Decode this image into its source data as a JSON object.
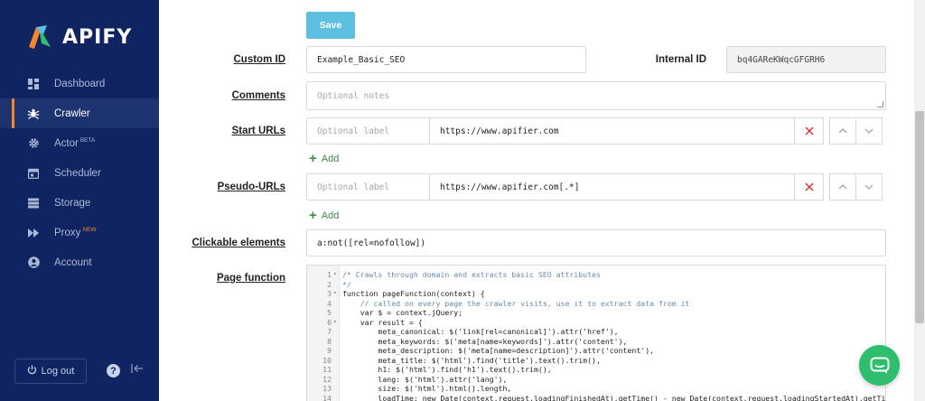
{
  "brand": {
    "name": "APIFY"
  },
  "sidebar": {
    "items": [
      {
        "label": "Dashboard",
        "icon": "dashboard-icon",
        "active": false
      },
      {
        "label": "Crawler",
        "icon": "spider-icon",
        "active": true
      },
      {
        "label": "Actor",
        "badge": "BETA",
        "icon": "gear-icon",
        "active": false
      },
      {
        "label": "Scheduler",
        "icon": "calendar-icon",
        "active": false
      },
      {
        "label": "Storage",
        "icon": "storage-icon",
        "active": false
      },
      {
        "label": "Proxy",
        "badge": "NEW",
        "icon": "fast-forward-icon",
        "active": false
      },
      {
        "label": "Account",
        "icon": "user-icon",
        "active": false
      }
    ],
    "logout_label": "Log out",
    "help_glyph": "?"
  },
  "form": {
    "save_label": "Save",
    "custom_id": {
      "label": "Custom ID",
      "value": "Example_Basic_SEO"
    },
    "internal_id": {
      "label": "Internal ID",
      "value": "bq4GAReKWqcGFGRH6"
    },
    "comments": {
      "label": "Comments",
      "placeholder": "Optional notes"
    },
    "start_urls": {
      "label": "Start URLs",
      "label_placeholder": "Optional label",
      "url": "https://www.apifier.com"
    },
    "pseudo_urls": {
      "label": "Pseudo-URLs",
      "label_placeholder": "Optional label",
      "url": "https://www.apifier.com[.*]"
    },
    "add_label": "Add",
    "clickable_elements": {
      "label": "Clickable elements",
      "value": "a:not([rel=nofollow])"
    },
    "page_function": {
      "label": "Page function",
      "lines": [
        {
          "n": "1",
          "fold": true,
          "text": "/* Crawls through domain and extracts basic SEO attributes",
          "comment": true
        },
        {
          "n": "2",
          "fold": false,
          "text": "*/",
          "comment": true
        },
        {
          "n": "3",
          "fold": true,
          "text": "function pageFunction(context) {",
          "comment": false
        },
        {
          "n": "4",
          "fold": false,
          "text": "    // called on every page the crawler visits, use it to extract data from it",
          "comment": true
        },
        {
          "n": "5",
          "fold": false,
          "text": "    var $ = context.jQuery;",
          "comment": false
        },
        {
          "n": "6",
          "fold": true,
          "text": "    var result = {",
          "comment": false
        },
        {
          "n": "7",
          "fold": false,
          "text": "        meta_canonical: $('link[rel=canonical]').attr('href'),",
          "comment": false
        },
        {
          "n": "8",
          "fold": false,
          "text": "        meta_keywords: $('meta[name=keywords]').attr('content'),",
          "comment": false
        },
        {
          "n": "9",
          "fold": false,
          "text": "        meta_description: $('meta[name=description]').attr('content'),",
          "comment": false
        },
        {
          "n": "10",
          "fold": false,
          "text": "        meta_title: $('html').find('title').text().trim(),",
          "comment": false
        },
        {
          "n": "11",
          "fold": false,
          "text": "        h1: $('html').find('h1').text().trim(),",
          "comment": false
        },
        {
          "n": "12",
          "fold": false,
          "text": "        lang: $('html').attr('lang'),",
          "comment": false
        },
        {
          "n": "13",
          "fold": false,
          "text": "        size: $('html').html().length,",
          "comment": false
        },
        {
          "n": "14",
          "fold": false,
          "text": "        loadTime: new Date(context.request.loadingFinishedAt).getTime() - new Date(context.request.loadingStartedAt).getTime()",
          "comment": false
        }
      ]
    }
  },
  "colors": {
    "sidebar_bg": "#0f2460",
    "accent": "#f4872c",
    "save": "#5ec0df",
    "add": "#3c8d3f",
    "remove": "#d9343b",
    "chat": "#2fbe6c"
  }
}
